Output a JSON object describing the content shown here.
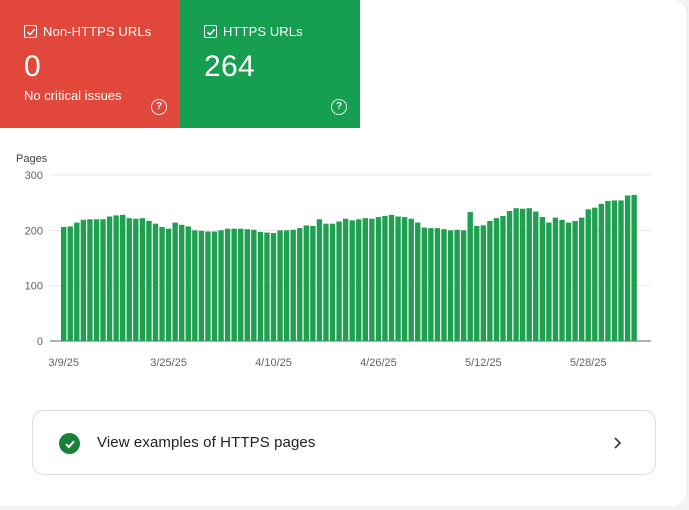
{
  "tiles": {
    "non_https": {
      "label": "Non-HTTPS URLs",
      "value": "0",
      "subtitle": "No critical issues",
      "color": "#e2473b",
      "checked": true
    },
    "https": {
      "label": "HTTPS URLs",
      "value": "264",
      "color": "#169f50",
      "checked": true
    }
  },
  "chart_data": {
    "type": "bar",
    "ylabel": "Pages",
    "ylim": [
      0,
      300
    ],
    "yticks": [
      0,
      100,
      200,
      300
    ],
    "grid": true,
    "bar_color": "#1ea050",
    "x_tick_labels": [
      "3/9/25",
      "3/25/25",
      "4/10/25",
      "4/26/25",
      "5/12/25",
      "5/28/25"
    ],
    "x_tick_indices": [
      0,
      16,
      32,
      48,
      64,
      80
    ],
    "values": [
      206,
      207,
      214,
      219,
      220,
      220,
      220,
      225,
      227,
      228,
      222,
      221,
      222,
      217,
      212,
      206,
      203,
      214,
      210,
      207,
      200,
      199,
      198,
      198,
      200,
      203,
      203,
      203,
      202,
      201,
      197,
      196,
      195,
      200,
      200,
      201,
      204,
      209,
      208,
      220,
      212,
      212,
      216,
      221,
      218,
      220,
      222,
      221,
      224,
      226,
      228,
      225,
      224,
      221,
      214,
      205,
      204,
      204,
      202,
      200,
      201,
      200,
      233,
      208,
      209,
      217,
      222,
      226,
      235,
      240,
      239,
      240,
      234,
      224,
      214,
      223,
      219,
      214,
      217,
      223,
      238,
      241,
      248,
      253,
      254,
      254,
      263,
      264
    ]
  },
  "examples_button": {
    "label": "View examples of HTTPS pages"
  }
}
